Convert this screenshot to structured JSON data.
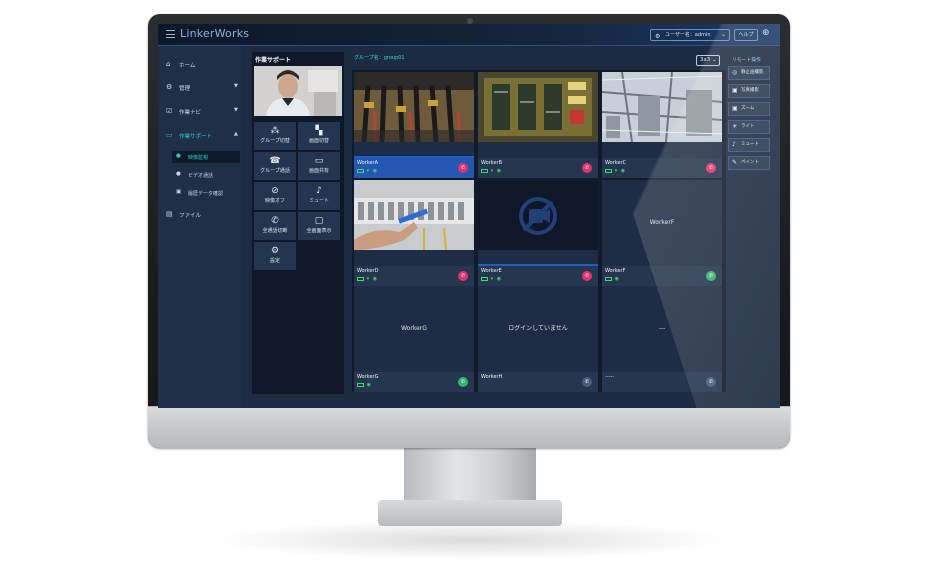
{
  "app": {
    "brand": "LinkerWorks"
  },
  "header": {
    "user_label": "ユーザー名：admin",
    "help_label": "ヘルプ",
    "globe_icon": "globe-icon"
  },
  "sidebar": {
    "items": [
      {
        "label": "ホーム",
        "icon": "home-icon"
      },
      {
        "label": "管理",
        "icon": "gear-icon"
      },
      {
        "label": "作業ナビ",
        "icon": "checklist-icon"
      },
      {
        "label": "作業サポート",
        "icon": "chat-icon"
      },
      {
        "label": "ファイル",
        "icon": "file-icon"
      }
    ],
    "sub_items": [
      {
        "label": "映像監視",
        "icon": "person-icon"
      },
      {
        "label": "ビデオ通話",
        "icon": "person-icon"
      },
      {
        "label": "履歴データ確認",
        "icon": "image-icon"
      }
    ]
  },
  "work_panel": {
    "title": "作業サポート",
    "tools": [
      {
        "label": "グループ切替",
        "icon": "group-switch-icon"
      },
      {
        "label": "画面切替",
        "icon": "screen-switch-icon"
      },
      {
        "label": "グループ通話",
        "icon": "group-call-icon"
      },
      {
        "label": "画面共有",
        "icon": "monitor-icon"
      },
      {
        "label": "映像オフ",
        "icon": "video-off-icon"
      },
      {
        "label": "ミュート",
        "icon": "mic-off-icon"
      },
      {
        "label": "全通話切断",
        "icon": "hangup-all-icon"
      },
      {
        "label": "全画面表示",
        "icon": "fullscreen-icon"
      },
      {
        "label": "設定",
        "icon": "gear-icon"
      }
    ]
  },
  "grid": {
    "group_label": "グループ名：group01",
    "layout_value": "3x3",
    "tiles": [
      {
        "name": "WorkerA",
        "selected": true,
        "call": "red"
      },
      {
        "name": "WorkerB",
        "selected": false,
        "call": "red"
      },
      {
        "name": "WorkerC",
        "selected": false,
        "call": "red"
      },
      {
        "name": "WorkerD",
        "selected": false,
        "call": "red"
      },
      {
        "name": "WorkerE",
        "selected": false,
        "call": "red"
      },
      {
        "name": "WorkerF",
        "center": "WorkerF",
        "call": "green"
      },
      {
        "name": "WorkerG",
        "center": "WorkerG",
        "call": "green"
      },
      {
        "name": "WorkerH",
        "center": "ログインしていません",
        "call": "grey"
      },
      {
        "name": "-----",
        "center": "---",
        "call": "grey"
      }
    ]
  },
  "remote_ops": {
    "title": "リモート操作",
    "buttons": [
      {
        "label": "静止画撮影",
        "icon": "camera-icon"
      },
      {
        "label": "写真撮影",
        "icon": "photo-icon"
      },
      {
        "label": "ズーム",
        "icon": "zoom-icon"
      },
      {
        "label": "ライト",
        "icon": "light-icon"
      },
      {
        "label": "ミュート",
        "icon": "mic-off-icon"
      },
      {
        "label": "ペイント",
        "icon": "pen-icon"
      }
    ]
  },
  "colors": {
    "accent": "#21d3c6",
    "selected_tile": "#2357b2",
    "end_call": "#e3336b",
    "start_call": "#34b36d"
  }
}
